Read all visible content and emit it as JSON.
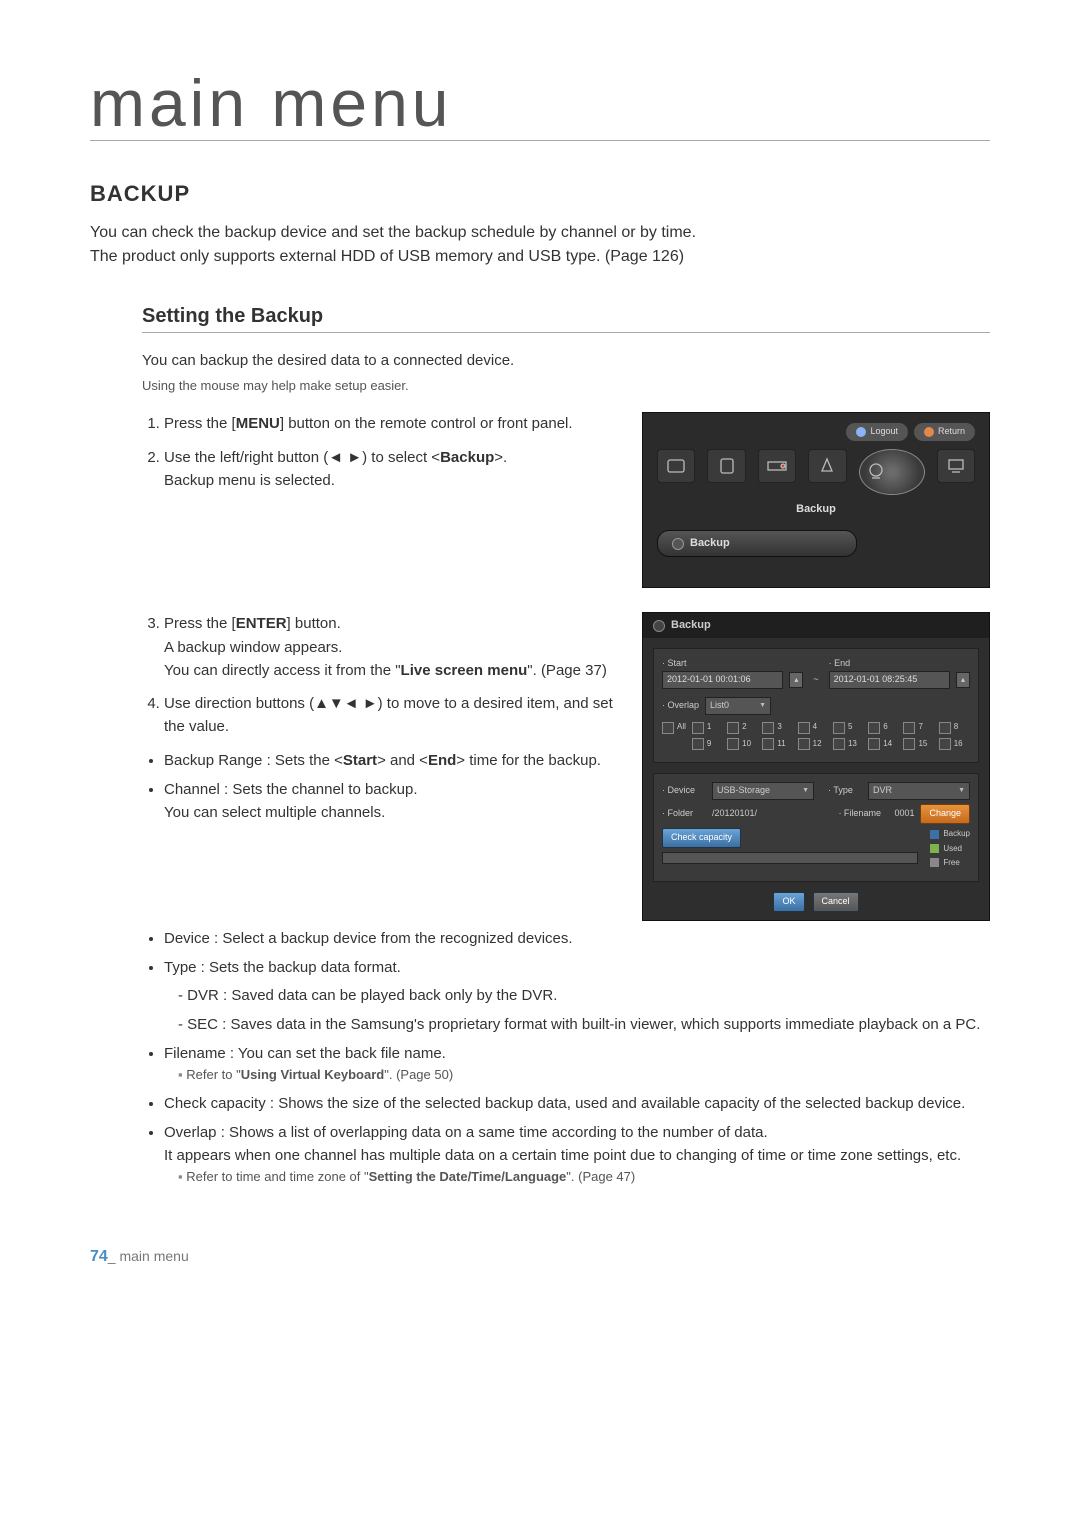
{
  "page_title": "main menu",
  "section": "BACKUP",
  "intro_line1": "You can check the backup device and set the backup schedule by channel or by time.",
  "intro_line2": "The product only supports external HDD of USB memory and USB type. (Page 126)",
  "sub_heading": "Setting the Backup",
  "sub_intro": "You can backup the desired data to a connected device.",
  "sub_intro_note": "Using the mouse may help make setup easier.",
  "step1_pre": "Press the [",
  "step1_bold": "MENU",
  "step1_post": "] button on the remote control or front panel.",
  "step2_pre": "Use the left/right button (◄ ►) to select <",
  "step2_bold": "Backup",
  "step2_post": ">.",
  "step2_line2": "Backup menu is selected.",
  "step3_pre": "Press the [",
  "step3_bold": "ENTER",
  "step3_post": "] button.",
  "step3_line2": "A backup window appears.",
  "step3_line3a": "You can directly access it from the \"",
  "step3_line3_bold": "Live screen menu",
  "step3_line3b": "\". (Page 37)",
  "step4": "Use direction buttons (▲▼◄ ►) to move to a desired item, and set the value.",
  "b_range_pre": "Backup Range : Sets the <",
  "b_range_s": "Start",
  "b_range_mid": "> and <",
  "b_range_e": "End",
  "b_range_post": "> time for the backup.",
  "b_channel_1": "Channel : Sets the channel to backup.",
  "b_channel_2": "You can select multiple channels.",
  "b_device": "Device : Select a backup device from the recognized devices.",
  "b_type": "Type : Sets the backup data format.",
  "b_type_dvr": "DVR : Saved data can be played back only by the DVR.",
  "b_type_sec": "SEC : Saves data in the Samsung's proprietary format with built-in viewer, which supports immediate playback on a PC.",
  "b_filename": "Filename : You can set the back file name.",
  "b_filename_ref_a": "Refer to \"",
  "b_filename_ref_b": "Using Virtual Keyboard",
  "b_filename_ref_c": "\". (Page 50)",
  "b_cap": "Check capacity : Shows the size of the selected backup data, used and available capacity of the selected backup device.",
  "b_overlap_1": "Overlap : Shows a list of overlapping data on a same time according to the number of data.",
  "b_overlap_2": "It appears when one channel has multiple data on a certain time point due to changing of time or time zone settings, etc.",
  "b_overlap_ref_a": "Refer to time and time zone of \"",
  "b_overlap_ref_b": "Setting the Date/Time/Language",
  "b_overlap_ref_c": "\". (Page 47)",
  "footer_num": "74",
  "footer_text": "_ main menu",
  "shot1": {
    "logout": "Logout",
    "return": "Return",
    "label": "Backup",
    "submenu": "Backup"
  },
  "shot2": {
    "title": "Backup",
    "start_lbl": "· Start",
    "start_val": "2012-01-01 00:01:06",
    "end_lbl": "· End",
    "end_val": "2012-01-01 08:25:45",
    "overlap_lbl": "· Overlap",
    "overlap_val": "List0",
    "all": "All",
    "ch": [
      "1",
      "2",
      "3",
      "4",
      "5",
      "6",
      "7",
      "8",
      "9",
      "10",
      "11",
      "12",
      "13",
      "14",
      "15",
      "16"
    ],
    "device_lbl": "· Device",
    "device_val": "USB-Storage",
    "folder_lbl": "· Folder",
    "folder_val": "/20120101/",
    "type_lbl": "· Type",
    "type_val": "DVR",
    "file_lbl": "· Filename",
    "file_val": "0001",
    "change": "Change",
    "checkcap": "Check capacity",
    "leg_backup": "Backup",
    "leg_used": "Used",
    "leg_free": "Free",
    "ok": "OK",
    "cancel": "Cancel"
  }
}
